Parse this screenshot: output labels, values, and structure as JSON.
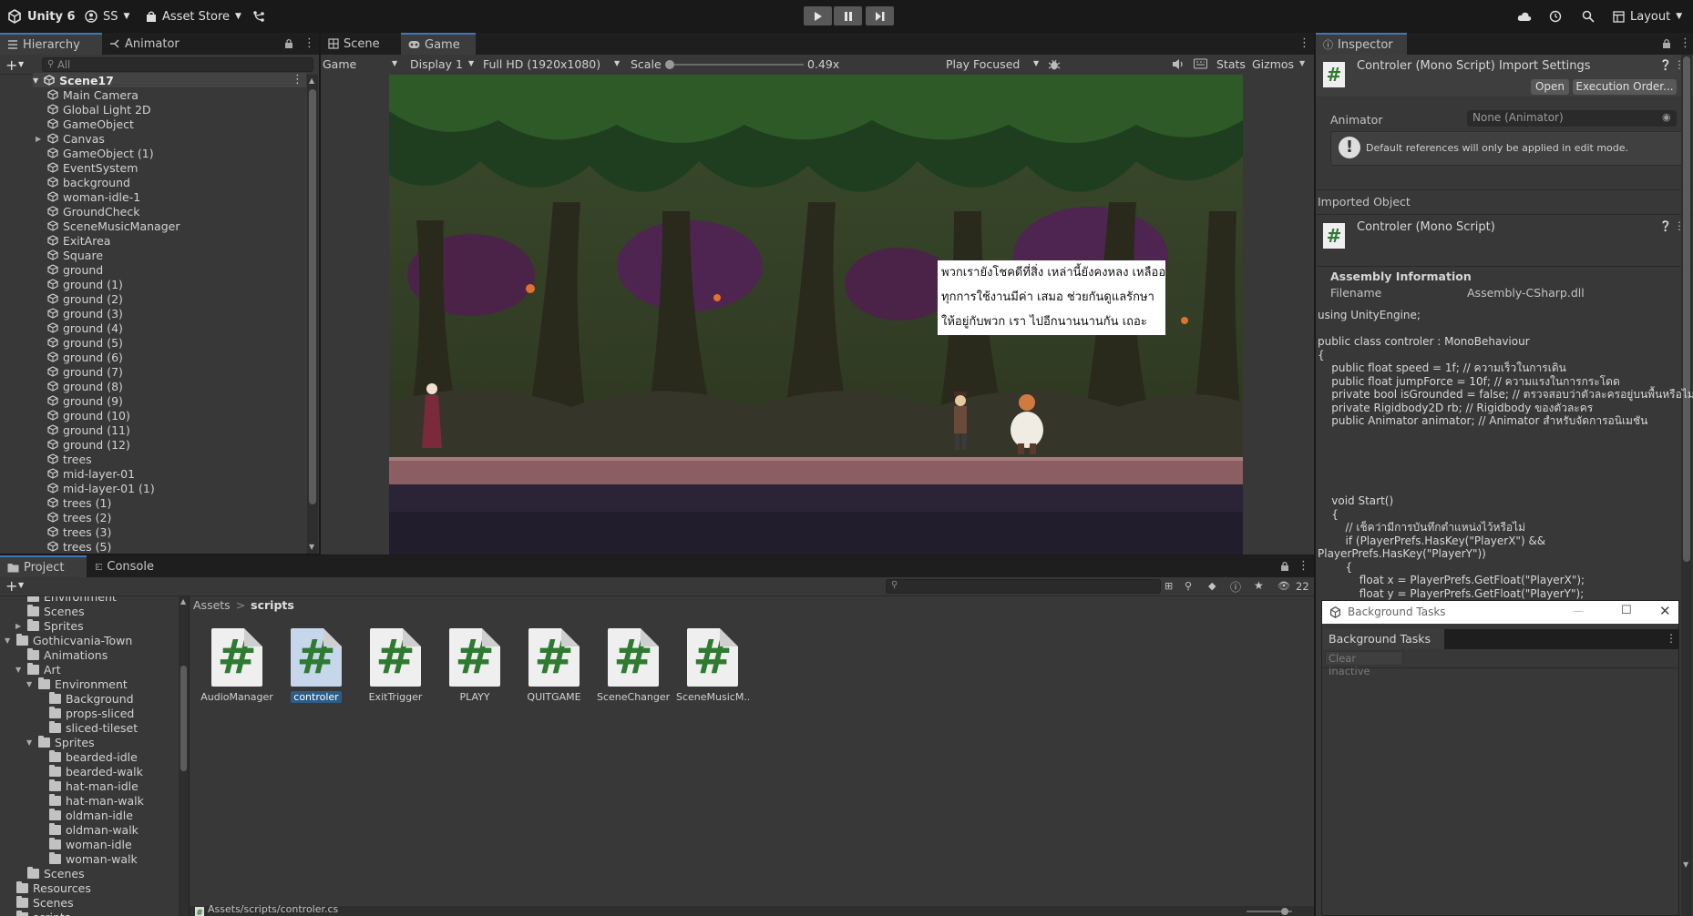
{
  "topbar": {
    "app": "Unity 6",
    "account": "SS",
    "asset_store": "Asset Store",
    "layout": "Layout"
  },
  "hierarchy": {
    "tabs": [
      "Hierarchy",
      "Animator"
    ],
    "search_placeholder": "All",
    "scene": "Scene17",
    "items": [
      "Main Camera",
      "Global Light 2D",
      "GameObject",
      "Canvas",
      "GameObject (1)",
      "EventSystem",
      "background",
      "woman-idle-1",
      "GroundCheck",
      "SceneMusicManager",
      "ExitArea",
      "Square",
      "ground",
      "ground (1)",
      "ground (2)",
      "ground (3)",
      "ground (4)",
      "ground (5)",
      "ground (6)",
      "ground (7)",
      "ground (8)",
      "ground (9)",
      "ground (10)",
      "ground (11)",
      "ground (12)",
      "trees",
      "mid-layer-01",
      "mid-layer-01 (1)",
      "trees (1)",
      "trees (2)",
      "trees (3)",
      "trees (5)"
    ]
  },
  "viewtabs": [
    "Scene",
    "Game"
  ],
  "gametoolbar": {
    "mode": "Game",
    "display": "Display 1",
    "resolution": "Full HD (1920x1080)",
    "scale_label": "Scale",
    "scale_value": "0.49x",
    "play_focus": "Play Focused",
    "stats": "Stats",
    "gizmos": "Gizmos"
  },
  "dialog": {
    "lines": [
      "พวกเรายังโชคดีที่สิ่ง เหล่านี้ยังคงหลง เหลืออยู่",
      "ทุกการใช้งานมีค่า เสมอ ช่วยกันดูแลรักษา",
      "ให้อยู่กับพวก เรา ไปอีกนานนานกัน เถอะ"
    ]
  },
  "inspector": {
    "tab": "Inspector",
    "title": "Controler (Mono Script) Import Settings",
    "open": "Open",
    "exec_order": "Execution Order...",
    "animator_label": "Animator",
    "animator_value": "None (Animator)",
    "warning": "Default references will only be applied in edit mode.",
    "imported_object": "Imported Object",
    "script_name": "Controler (Mono Script)",
    "assembly_info": "Assembly Information",
    "filename_label": "Filename",
    "filename_value": "Assembly-CSharp.dll",
    "code1": [
      "using UnityEngine;",
      "",
      "public class controler : MonoBehaviour",
      "{",
      "    public float speed = 1f; // ความเร็วในการเดิน",
      "    public float jumpForce = 10f; // ความแรงในการกระโดด",
      "    private bool isGrounded = false; // ตรวจสอบว่าตัวละครอยู่บนพื้นหรือไม่",
      "    private Rigidbody2D rb; // Rigidbody ของตัวละคร",
      "    public Animator animator; // Animator สำหรับจัดการอนิเมชัน"
    ],
    "code2": [
      "    void Start()",
      "    {",
      "        // เช็คว่ามีการบันทึกตำแหน่งไว้หรือไม่",
      "        if (PlayerPrefs.HasKey(\"PlayerX\") &&",
      "PlayerPrefs.HasKey(\"PlayerY\"))",
      "        {",
      "            float x = PlayerPrefs.GetFloat(\"PlayerX\");",
      "            float y = PlayerPrefs.GetFloat(\"PlayerY\");"
    ]
  },
  "background_tasks": {
    "window_title": "Background Tasks",
    "tab": "Background Tasks",
    "clear": "Clear Inactive"
  },
  "project": {
    "tabs": [
      "Project",
      "Console"
    ],
    "breadcrumb": [
      "Assets",
      "scripts"
    ],
    "count": "22",
    "tree": [
      {
        "label": "Environment",
        "level": 1,
        "arrow": false
      },
      {
        "label": "Scenes",
        "level": 1,
        "arrow": false
      },
      {
        "label": "Sprites",
        "level": 1,
        "arrow": "right"
      },
      {
        "label": "Gothicvania-Town",
        "level": 0,
        "arrow": "down"
      },
      {
        "label": "Animations",
        "level": 1,
        "arrow": false
      },
      {
        "label": "Art",
        "level": 1,
        "arrow": "down"
      },
      {
        "label": "Environment",
        "level": 2,
        "arrow": "down"
      },
      {
        "label": "Background",
        "level": 3,
        "arrow": false
      },
      {
        "label": "props-sliced",
        "level": 3,
        "arrow": false
      },
      {
        "label": "sliced-tileset",
        "level": 3,
        "arrow": false
      },
      {
        "label": "Sprites",
        "level": 2,
        "arrow": "down"
      },
      {
        "label": "bearded-idle",
        "level": 3,
        "arrow": false
      },
      {
        "label": "bearded-walk",
        "level": 3,
        "arrow": false
      },
      {
        "label": "hat-man-idle",
        "level": 3,
        "arrow": false
      },
      {
        "label": "hat-man-walk",
        "level": 3,
        "arrow": false
      },
      {
        "label": "oldman-idle",
        "level": 3,
        "arrow": false
      },
      {
        "label": "oldman-walk",
        "level": 3,
        "arrow": false
      },
      {
        "label": "woman-idle",
        "level": 3,
        "arrow": false
      },
      {
        "label": "woman-walk",
        "level": 3,
        "arrow": false
      },
      {
        "label": "Scenes",
        "level": 1,
        "arrow": false
      },
      {
        "label": "Resources",
        "level": 0,
        "arrow": false
      },
      {
        "label": "Scenes",
        "level": 0,
        "arrow": false
      },
      {
        "label": "scripts",
        "level": 0,
        "arrow": false
      }
    ],
    "assets": [
      "AudioManager",
      "controler",
      "ExitTrigger",
      "PLAYY",
      "QUITGAME",
      "SceneChanger",
      "SceneMusicM..."
    ],
    "selected_asset": 1,
    "status_path": "Assets/scripts/controler.cs"
  },
  "colors": {
    "accent": "#3a79bb",
    "selection": "#2c5d87",
    "background": "#383838",
    "toolbar": "#191919"
  }
}
